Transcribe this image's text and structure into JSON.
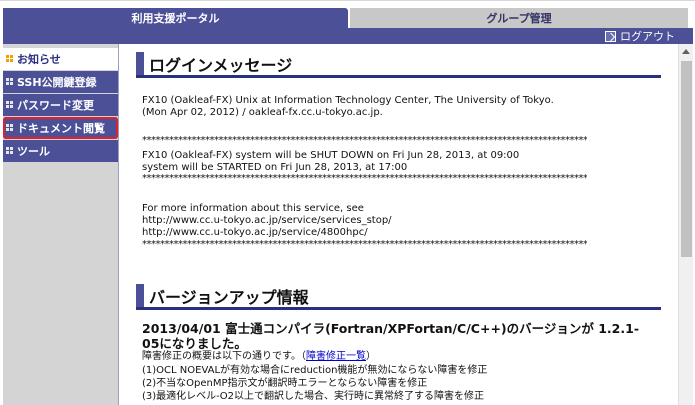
{
  "tabs": {
    "portal": "利用支援ポータル",
    "group": "グループ管理"
  },
  "header": {
    "logout_label": "ログアウト"
  },
  "sidebar": {
    "items": [
      {
        "label": "お知らせ"
      },
      {
        "label": "SSH公開鍵登録"
      },
      {
        "label": "パスワード変更"
      },
      {
        "label": "ドキュメント閲覧"
      },
      {
        "label": "ツール"
      }
    ]
  },
  "login": {
    "title": "ログインメッセージ",
    "lines": [
      "FX10 (Oakleaf-FX) Unix at Information Technology Center, The University of Tokyo.",
      "(Mon Apr 02, 2012) / oakleaf-fx.cc.u-tokyo.ac.jp.",
      "FX10 (Oakleaf-FX) system will be SHUT DOWN on Fri Jun 28, 2013, at 09:00",
      "system will be STARTED on Fri Jun 28, 2013, at 17:00",
      "For more information about this service, see",
      "http://www.cc.u-tokyo.ac.jp/service/services_stop/",
      "http://www.cc.u-tokyo.ac.jp/service/4800hpc/"
    ],
    "stars": "********************************************************************************************************"
  },
  "version": {
    "title": "バージョンアップ情報",
    "heading": "2013/04/01 富士通コンパイラ(Fortran/XPFortan/C/C++)のバージョンが 1.2.1-05になりました。",
    "summary_prefix": "障害修正の概要は以下の通りです。（",
    "summary_link": "障害修正一覧",
    "summary_suffix": "）",
    "items": [
      "(1)OCL NOEVALが有効な場合にreduction機能が無効にならない障害を修正",
      "(2)不当なOpenMP指示文が翻訳時エラーとならない障害を修正",
      "(3)最適化レベル-O2以上で翻訳した場合、実行時に異常終了する障害を修正"
    ]
  }
}
